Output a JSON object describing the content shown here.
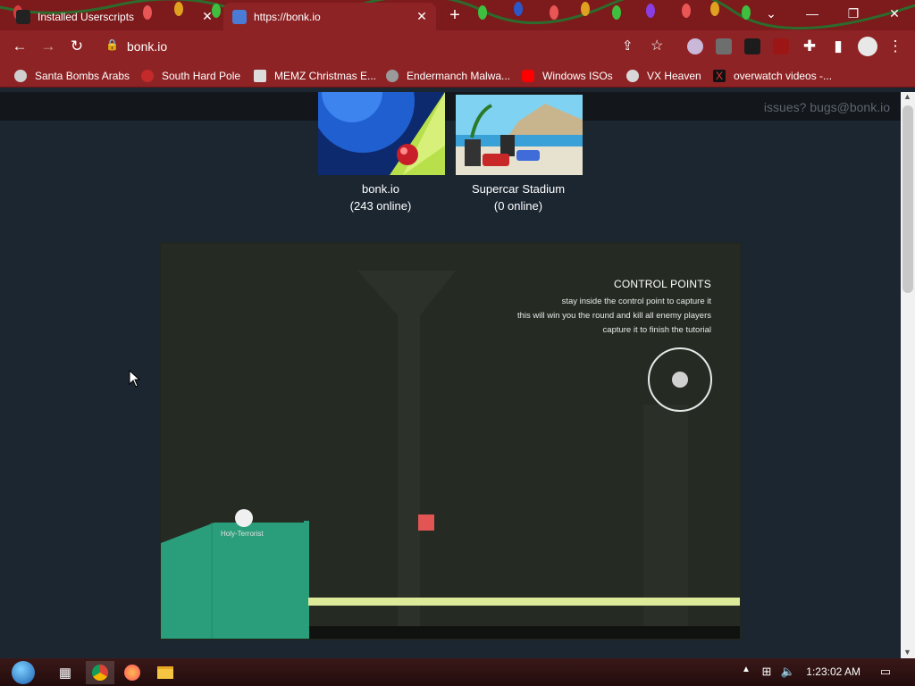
{
  "browser": {
    "tabs": [
      {
        "title": "Installed Userscripts",
        "active": false,
        "favicon_color": "#e8e8e8"
      },
      {
        "title": "https://bonk.io",
        "active": true,
        "favicon_color": "#4a7bd6"
      }
    ],
    "url": "bonk.io",
    "bookmarks": [
      {
        "label": "Santa Bombs Arabs",
        "icon": "bomb-icon",
        "color": "#cfcfcf"
      },
      {
        "label": "South Hard Pole",
        "icon": "virus-icon",
        "color": "#c42a2a"
      },
      {
        "label": "MEMZ Christmas E...",
        "icon": "window-icon",
        "color": "#dcdcdc"
      },
      {
        "label": "Endermanch Malwa...",
        "icon": "raccoon-icon",
        "color": "#9a9a9a"
      },
      {
        "label": "Windows ISOs",
        "icon": "youtube-icon",
        "color": "#ff0000"
      },
      {
        "label": "VX Heaven",
        "icon": "skull-icon",
        "color": "#d8d8d8"
      },
      {
        "label": "overwatch videos -...",
        "icon": "x-icon",
        "color": "#111111"
      }
    ]
  },
  "page": {
    "issues_text": "issues? bugs@bonk.io",
    "modes": [
      {
        "name": "bonk.io",
        "online": "(243 online)"
      },
      {
        "name": "Supercar Stadium",
        "online": "(0 online)"
      }
    ],
    "tutorial": {
      "title": "CONTROL POINTS",
      "lines": [
        "stay inside the control point to capture it",
        "this will win you the round and kill all enemy players",
        "capture it to finish the tutorial"
      ],
      "player_name": "Holy-Terrorist"
    }
  },
  "taskbar": {
    "clock": "1:23:02 AM"
  },
  "colors": {
    "accent": "#8e2325",
    "platform": "#2a9e7a",
    "floor": "#dcea9a",
    "enemy": "#e25555"
  }
}
